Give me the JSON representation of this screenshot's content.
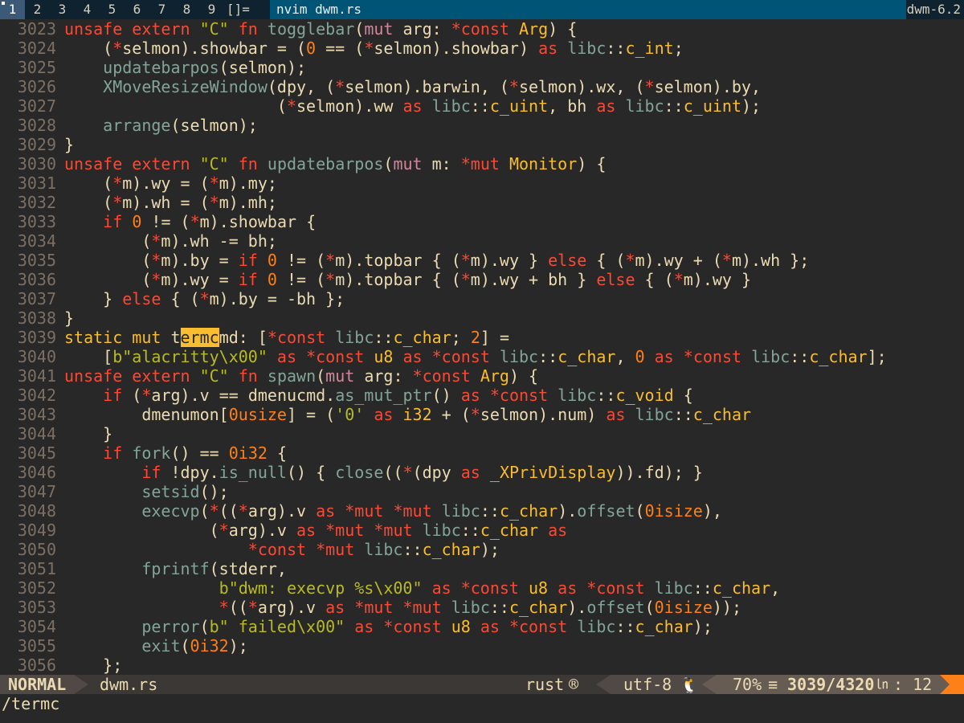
{
  "bar": {
    "tags": [
      "1",
      "2",
      "3",
      "4",
      "5",
      "6",
      "7",
      "8",
      "9"
    ],
    "selected_tag": "1",
    "layout_symbol": "[]=",
    "window_title": "nvim dwm.rs",
    "status_text": "dwm-6.2"
  },
  "editor": {
    "lines": [
      {
        "n": "3023",
        "html": "<span class=\"kw\">unsafe</span> <span class=\"kw\">extern</span> <span class=\"str\">\"C\"</span> <span class=\"kw\">fn</span> <span class=\"fn\">togglebar</span>(<span class=\"kw2\">mut</span> arg: <span class=\"kw\">*const</span> <span class=\"ty\">Arg</span>) {"
      },
      {
        "n": "3024",
        "html": "    (<span class=\"kw\">*</span>selmon).showbar = (<span class=\"num\">0</span> == (<span class=\"kw\">*</span>selmon).showbar) <span class=\"kw\">as</span> <span class=\"ns\">libc</span>::<span class=\"ty\">c_int</span>;"
      },
      {
        "n": "3025",
        "html": "    <span class=\"fn\">updatebarpos</span>(selmon);"
      },
      {
        "n": "3026",
        "html": "    <span class=\"fn\">XMoveResizeWindow</span>(dpy, (<span class=\"kw\">*</span>selmon).barwin, (<span class=\"kw\">*</span>selmon).wx, (<span class=\"kw\">*</span>selmon).by,"
      },
      {
        "n": "3027",
        "html": "                      (<span class=\"kw\">*</span>selmon).ww <span class=\"kw\">as</span> <span class=\"ns\">libc</span>::<span class=\"ty\">c_uint</span>, bh <span class=\"kw\">as</span> <span class=\"ns\">libc</span>::<span class=\"ty\">c_uint</span>);"
      },
      {
        "n": "3028",
        "html": "    <span class=\"fn\">arrange</span>(selmon);"
      },
      {
        "n": "3029",
        "html": "}"
      },
      {
        "n": "3030",
        "html": "<span class=\"kw\">unsafe</span> <span class=\"kw\">extern</span> <span class=\"str\">\"C\"</span> <span class=\"kw\">fn</span> <span class=\"fn\">updatebarpos</span>(<span class=\"kw2\">mut</span> m: <span class=\"kw\">*mut</span> <span class=\"ty\">Monitor</span>) {"
      },
      {
        "n": "3031",
        "html": "    (<span class=\"kw\">*</span>m).wy = (<span class=\"kw\">*</span>m).my;"
      },
      {
        "n": "3032",
        "html": "    (<span class=\"kw\">*</span>m).wh = (<span class=\"kw\">*</span>m).mh;"
      },
      {
        "n": "3033",
        "html": "    <span class=\"kw\">if</span> <span class=\"num\">0</span> != (<span class=\"kw\">*</span>m).showbar {"
      },
      {
        "n": "3034",
        "html": "        (<span class=\"kw\">*</span>m).wh -= bh;"
      },
      {
        "n": "3035",
        "html": "        (<span class=\"kw\">*</span>m).by = <span class=\"kw\">if</span> <span class=\"num\">0</span> != (<span class=\"kw\">*</span>m).topbar { (<span class=\"kw\">*</span>m).wy } <span class=\"kw\">else</span> { (<span class=\"kw\">*</span>m).wy + (<span class=\"kw\">*</span>m).wh };"
      },
      {
        "n": "3036",
        "html": "        (<span class=\"kw\">*</span>m).wy = <span class=\"kw\">if</span> <span class=\"num\">0</span> != (<span class=\"kw\">*</span>m).topbar { (<span class=\"kw\">*</span>m).wy + bh } <span class=\"kw\">else</span> { (<span class=\"kw\">*</span>m).wy }"
      },
      {
        "n": "3037",
        "html": "    } <span class=\"kw\">else</span> { (<span class=\"kw\">*</span>m).by = -bh };"
      },
      {
        "n": "3038",
        "html": "}"
      },
      {
        "n": "3039",
        "html": "<span class=\"ty\">static</span> <span class=\"ty\">mut</span> t<span class=\"hl\">ermc</span>md: [<span class=\"kw\">*const</span> <span class=\"ns\">libc</span>::<span class=\"ty\">c_char</span>; <span class=\"num\">2</span>] ="
      },
      {
        "n": "3040",
        "html": "    [<span class=\"str\">b\"alacritty\\x00\"</span> <span class=\"kw\">as</span> <span class=\"kw\">*const</span> <span class=\"ty\">u8</span> <span class=\"kw\">as</span> <span class=\"kw\">*const</span> <span class=\"ns\">libc</span>::<span class=\"ty\">c_char</span>, <span class=\"num\">0</span> <span class=\"kw\">as</span> <span class=\"kw\">*const</span> <span class=\"ns\">libc</span>::<span class=\"ty\">c_char</span>];"
      },
      {
        "n": "3041",
        "html": "<span class=\"kw\">unsafe</span> <span class=\"kw\">extern</span> <span class=\"str\">\"C\"</span> <span class=\"kw\">fn</span> <span class=\"fn\">spawn</span>(<span class=\"kw2\">mut</span> arg: <span class=\"kw\">*const</span> <span class=\"ty\">Arg</span>) {"
      },
      {
        "n": "3042",
        "html": "    <span class=\"kw\">if</span> (<span class=\"kw\">*</span>arg).v == dmenucmd.<span class=\"fn\">as_mut_ptr</span>() <span class=\"kw\">as</span> <span class=\"kw\">*const</span> <span class=\"ns\">libc</span>::<span class=\"ty\">c_void</span> {"
      },
      {
        "n": "3043",
        "html": "        dmenumon[<span class=\"num\">0usize</span>] = (<span class=\"str\">'0'</span> <span class=\"kw\">as</span> <span class=\"ty\">i32</span> + (<span class=\"kw\">*</span>selmon).num) <span class=\"kw\">as</span> <span class=\"ns\">libc</span>::<span class=\"ty\">c_char</span>"
      },
      {
        "n": "3044",
        "html": "    }"
      },
      {
        "n": "3045",
        "html": "    <span class=\"kw\">if</span> <span class=\"fn\">fork</span>() == <span class=\"num\">0i32</span> {"
      },
      {
        "n": "3046",
        "html": "        <span class=\"kw\">if</span> !dpy.<span class=\"fn\">is_null</span>() { <span class=\"fn\">close</span>((<span class=\"kw\">*</span>(dpy <span class=\"kw\">as</span> <span class=\"ty\">_XPrivDisplay</span>)).fd); }"
      },
      {
        "n": "3047",
        "html": "        <span class=\"fn\">setsid</span>();"
      },
      {
        "n": "3048",
        "html": "        <span class=\"fn\">execvp</span>(<span class=\"kw\">*</span>((<span class=\"kw\">*</span>arg).v <span class=\"kw\">as</span> <span class=\"kw\">*mut</span> <span class=\"kw\">*mut</span> <span class=\"ns\">libc</span>::<span class=\"ty\">c_char</span>).<span class=\"fn\">offset</span>(<span class=\"num\">0isize</span>),"
      },
      {
        "n": "3049",
        "html": "               (<span class=\"kw\">*</span>arg).v <span class=\"kw\">as</span> <span class=\"kw\">*mut</span> <span class=\"kw\">*mut</span> <span class=\"ns\">libc</span>::<span class=\"ty\">c_char</span> <span class=\"kw\">as</span>"
      },
      {
        "n": "3050",
        "html": "                   <span class=\"kw\">*const</span> <span class=\"kw\">*mut</span> <span class=\"ns\">libc</span>::<span class=\"ty\">c_char</span>);"
      },
      {
        "n": "3051",
        "html": "        <span class=\"fn\">fprintf</span>(stderr,"
      },
      {
        "n": "3052",
        "html": "                <span class=\"str\">b\"dwm: execvp %s\\x00\"</span> <span class=\"kw\">as</span> <span class=\"kw\">*const</span> <span class=\"ty\">u8</span> <span class=\"kw\">as</span> <span class=\"kw\">*const</span> <span class=\"ns\">libc</span>::<span class=\"ty\">c_char</span>,"
      },
      {
        "n": "3053",
        "html": "                <span class=\"kw\">*</span>((<span class=\"kw\">*</span>arg).v <span class=\"kw\">as</span> <span class=\"kw\">*mut</span> <span class=\"kw\">*mut</span> <span class=\"ns\">libc</span>::<span class=\"ty\">c_char</span>).<span class=\"fn\">offset</span>(<span class=\"num\">0isize</span>));"
      },
      {
        "n": "3054",
        "html": "        <span class=\"fn\">perror</span>(<span class=\"str\">b\" failed\\x00\"</span> <span class=\"kw\">as</span> <span class=\"kw\">*const</span> <span class=\"ty\">u8</span> <span class=\"kw\">as</span> <span class=\"kw\">*const</span> <span class=\"ns\">libc</span>::<span class=\"ty\">c_char</span>);"
      },
      {
        "n": "3055",
        "html": "        <span class=\"fn\">exit</span>(<span class=\"num\">0i32</span>);"
      },
      {
        "n": "3056",
        "html": "    };"
      }
    ]
  },
  "statusline": {
    "mode": "NORMAL",
    "filename": "dwm.rs",
    "filetype": "rust",
    "filetype_icon": "rust-icon",
    "encoding": "utf-8",
    "os_icon": "tux-icon",
    "percent": "70%",
    "percent_icon": "≡",
    "line_position": "3039/4320",
    "line_icon": "㏑",
    "column": ": 12"
  },
  "cmdline": {
    "text": "/termc"
  },
  "colors": {
    "bar_bg": "#0e2230",
    "title_bg": "#005577",
    "editor_bg": "#282828",
    "search_highlight": "#fabd2f",
    "warning": "#fe8019"
  }
}
